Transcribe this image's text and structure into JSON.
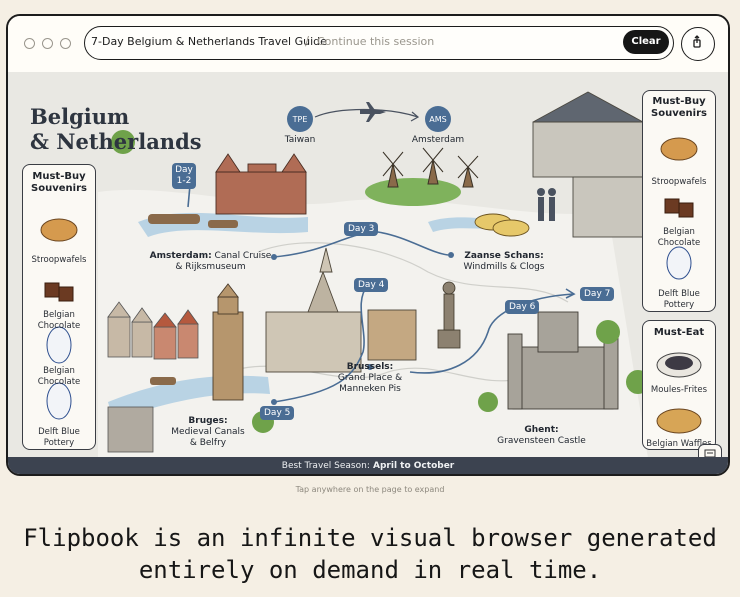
{
  "address_bar": {
    "title": "7-Day Belgium & Netherlands Travel Guide",
    "separator": "/",
    "placeholder": "Continue this session",
    "clear_label": "Clear"
  },
  "map": {
    "title_line1": "Belgium",
    "title_line2": "& Netherlands",
    "flight": {
      "from_code": "TPE",
      "from_name": "Taiwan",
      "to_code": "AMS",
      "to_name": "Amsterdam"
    },
    "left_panel": {
      "heading_line1": "Must-Buy",
      "heading_line2": "Souvenirs",
      "items": [
        {
          "label_line1": "Stroopwafels",
          "label_line2": ""
        },
        {
          "label_line1": "Belgian",
          "label_line2": "Chocolate"
        },
        {
          "label_line1": "Belgian",
          "label_line2": "Chocolate"
        },
        {
          "label_line1": "Delft Blue",
          "label_line2": "Pottery"
        }
      ]
    },
    "right_panel_buy": {
      "heading_line1": "Must-Buy",
      "heading_line2": "Souvenirs",
      "items": [
        {
          "label_line1": "Stroopwafels",
          "label_line2": ""
        },
        {
          "label_line1": "Belgian",
          "label_line2": "Chocolate"
        },
        {
          "label_line1": "Delft Blue",
          "label_line2": "Pottery"
        }
      ]
    },
    "right_panel_eat": {
      "heading": "Must-Eat",
      "items": [
        {
          "label": "Moules-Frites"
        },
        {
          "label": "Belgian Waffles"
        }
      ]
    },
    "days": {
      "d12_line1": "Day",
      "d12_line2": "1-2",
      "d3": "Day 3",
      "d4": "Day 4",
      "d5": "Day 5",
      "d6": "Day 6",
      "d7": "Day 7"
    },
    "stops": {
      "amsterdam_bold": "Amsterdam:",
      "amsterdam_rest": " Canal Cruise",
      "amsterdam_line2": "& Rijksmuseum",
      "zaanse_line1": "Zaanse Schans:",
      "zaanse_line2": "Windmills & Clogs",
      "brussels_line1": "Brussels:",
      "brussels_line2": "Grand Place &",
      "brussels_line3": "Manneken Pis",
      "bruges_line1": "Bruges:",
      "bruges_line2": "Medieval Canals",
      "bruges_line3": "& Belfry",
      "ghent_line1": "Ghent:",
      "ghent_line2": "Gravensteen Castle"
    },
    "footer_prefix": "Best Travel Season:",
    "footer_value": " April to October"
  },
  "hint": "Tap anywhere on the page to expand",
  "tagline_line1": "Flipbook is an infinite visual browser generated",
  "tagline_line2": "entirely on demand in real time.",
  "colors": {
    "route": "#4a6d94",
    "footer": "#3c4350",
    "accent_dark": "#161616"
  }
}
